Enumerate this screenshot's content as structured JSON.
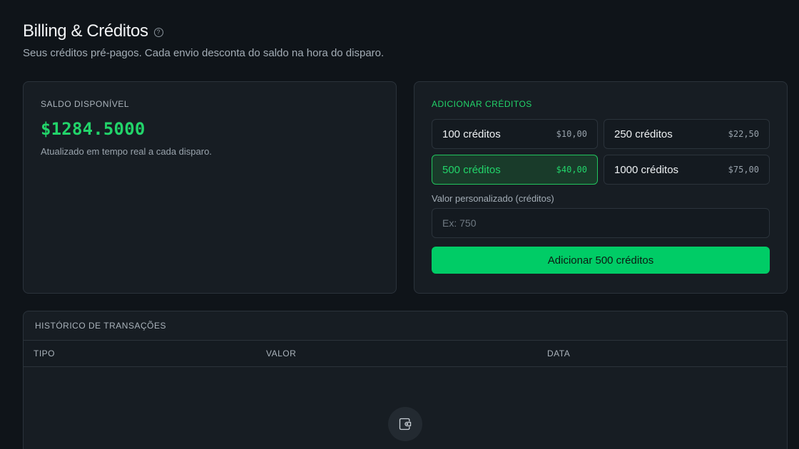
{
  "header": {
    "title": "Billing & Créditos",
    "subtitle": "Seus créditos pré-pagos. Cada envio desconta do saldo na hora do disparo."
  },
  "balance": {
    "label": "SALDO DISPONÍVEL",
    "value": "$1284.5000",
    "note": "Atualizado em tempo real a cada disparo."
  },
  "add_credits": {
    "label": "ADICIONAR CRÉDITOS",
    "packages": [
      {
        "name": "100 créditos",
        "price": "$10,00",
        "selected": false
      },
      {
        "name": "250 créditos",
        "price": "$22,50",
        "selected": false
      },
      {
        "name": "500 créditos",
        "price": "$40,00",
        "selected": true
      },
      {
        "name": "1000 créditos",
        "price": "$75,00",
        "selected": false
      }
    ],
    "custom_label": "Valor personalizado (créditos)",
    "custom_placeholder": "Ex: 750",
    "button_label": "Adicionar 500 créditos"
  },
  "history": {
    "label": "HISTÓRICO DE TRANSAÇÕES",
    "columns": [
      "TIPO",
      "VALOR",
      "DATA"
    ]
  },
  "colors": {
    "accent": "#22d46a",
    "button": "#00cc66",
    "background": "#0f1419",
    "card": "#171d23"
  },
  "icons": {
    "help": "help-circle-icon",
    "empty": "wallet-icon"
  }
}
